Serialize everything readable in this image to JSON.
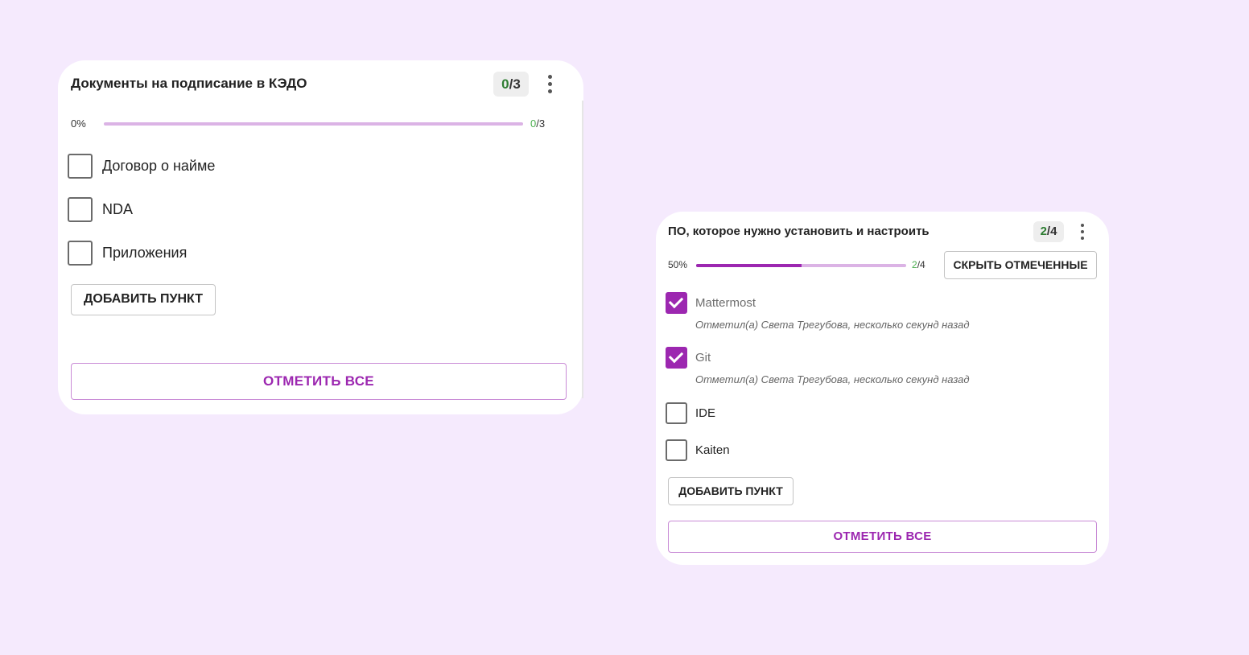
{
  "colors": {
    "background": "#f5eafd",
    "accent": "#9c27b0",
    "progress_track": "#dbb3e5",
    "done_count": "#2e7d32"
  },
  "card1": {
    "title": "Документы на подписание в КЭДО",
    "badge": {
      "done": "0",
      "rest": "/3"
    },
    "progress": {
      "percent_text": "0%",
      "value": 0,
      "done": "0",
      "rest": "/3"
    },
    "items": [
      {
        "label": "Договор о найме",
        "checked": false
      },
      {
        "label": "NDA",
        "checked": false
      },
      {
        "label": "Приложения",
        "checked": false
      }
    ],
    "add_button": "ДОБАВИТЬ ПУНКТ",
    "check_all_button": "ОТМЕТИТЬ ВСЕ",
    "menu_icon": "kebab-menu-icon"
  },
  "card2": {
    "title": "ПО, которое нужно установить и настроить",
    "badge": {
      "done": "2",
      "rest": "/4"
    },
    "progress": {
      "percent_text": "50%",
      "value": 0.5,
      "done": "2",
      "rest": "/4"
    },
    "hide_checked_button": "СКРЫТЬ ОТМЕЧЕННЫЕ",
    "items": [
      {
        "label": "Mattermost",
        "checked": true,
        "meta": "Отметил(а) Света Трегубова, несколько секунд назад"
      },
      {
        "label": "Git",
        "checked": true,
        "meta": "Отметил(а) Света Трегубова, несколько секунд назад"
      },
      {
        "label": "IDE",
        "checked": false
      },
      {
        "label": "Kaiten",
        "checked": false
      }
    ],
    "add_button": "ДОБАВИТЬ ПУНКТ",
    "check_all_button": "ОТМЕТИТЬ ВСЕ",
    "menu_icon": "kebab-menu-icon"
  }
}
